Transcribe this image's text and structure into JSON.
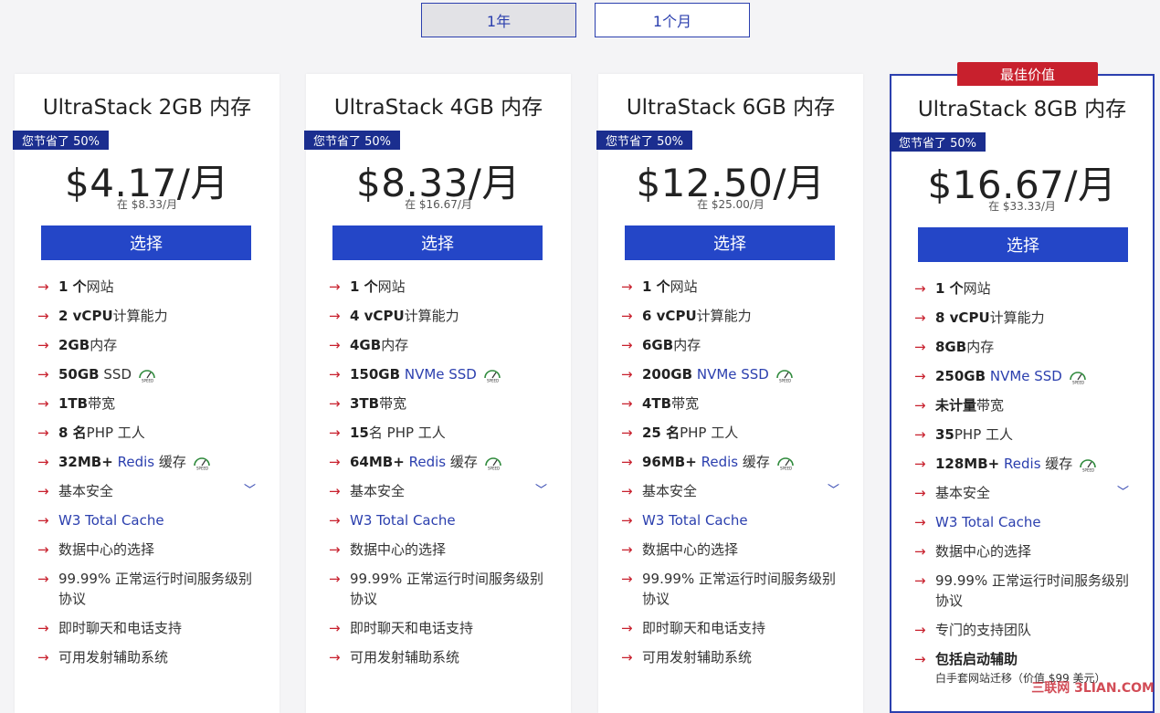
{
  "toggle": {
    "year": "1年",
    "month": "1个月"
  },
  "best_tag": "最佳价值",
  "save_badge": "您节省了 50%",
  "select_label": "选择",
  "plans": [
    {
      "title": "UltraStack 2GB 内存",
      "price": "$4.17/月",
      "orig": "在 $8.33/月",
      "features": {
        "sites_b": "1 个",
        "sites": "网站",
        "cpu_b": "2 vCPU",
        "cpu": "计算能力",
        "ram_b": "2GB",
        "ram": "内存",
        "ssd_b": "50GB",
        "ssd": "SSD",
        "bw_b": "1TB",
        "bw": "带宽",
        "php_b": "8 名",
        "php": "PHP 工人",
        "redis_b": "32MB+",
        "redis_link": "Redis",
        "redis": "缓存",
        "security": "基本安全",
        "w3": "W3 Total Cache",
        "dc": "数据中心的选择",
        "sla": "99.99% 正常运行时间服务级别协议",
        "chat": "即时聊天和电话支持",
        "launch": "可用发射辅助系统"
      }
    },
    {
      "title": "UltraStack 4GB 内存",
      "price": "$8.33/月",
      "orig": "在 $16.67/月",
      "features": {
        "sites_b": "1 个",
        "sites": "网站",
        "cpu_b": "4 vCPU",
        "cpu": "计算能力",
        "ram_b": "4GB",
        "ram": "内存",
        "ssd_b": "150GB",
        "ssd": "NVMe SSD",
        "bw_b": "3TB",
        "bw": "带宽",
        "php_b": "15",
        "php": "名 PHP 工人",
        "redis_b": "64MB+",
        "redis_link": "Redis",
        "redis": "缓存",
        "security": "基本安全",
        "w3": "W3 Total Cache",
        "dc": "数据中心的选择",
        "sla": "99.99% 正常运行时间服务级别协议",
        "chat": "即时聊天和电话支持",
        "launch": "可用发射辅助系统"
      }
    },
    {
      "title": "UltraStack 6GB 内存",
      "price": "$12.50/月",
      "orig": "在 $25.00/月",
      "features": {
        "sites_b": "1 个",
        "sites": "网站",
        "cpu_b": "6 vCPU",
        "cpu": "计算能力",
        "ram_b": "6GB",
        "ram": "内存",
        "ssd_b": "200GB",
        "ssd": "NVMe SSD",
        "bw_b": "4TB",
        "bw": "带宽",
        "php_b": "25 名",
        "php": "PHP 工人",
        "redis_b": "96MB+",
        "redis_link": "Redis",
        "redis": "缓存",
        "security": "基本安全",
        "w3": "W3 Total Cache",
        "dc": "数据中心的选择",
        "sla": "99.99% 正常运行时间服务级别协议",
        "chat": "即时聊天和电话支持",
        "launch": "可用发射辅助系统"
      }
    },
    {
      "title": "UltraStack 8GB 内存",
      "price": "$16.67/月",
      "orig": "在 $33.33/月",
      "features": {
        "sites_b": "1 个",
        "sites": "网站",
        "cpu_b": "8 vCPU",
        "cpu": "计算能力",
        "ram_b": "8GB",
        "ram": "内存",
        "ssd_b": "250GB",
        "ssd": "NVMe SSD",
        "bw_b": "未计量",
        "bw": "带宽",
        "php_b": "35",
        "php": "PHP 工人",
        "redis_b": "128MB+",
        "redis_link": "Redis",
        "redis": "缓存",
        "security": "基本安全",
        "w3": "W3 Total Cache",
        "dc": "数据中心的选择",
        "sla": "99.99% 正常运行时间服务级别协议",
        "team": "专门的支持团队",
        "launch_b": "包括启动辅助",
        "launch_sub": "白手套网站迁移（价值 $99 美元）"
      }
    }
  ],
  "watermark": "三联网 3LIAN.COM",
  "icons": {
    "arrow": "arrow-right-icon",
    "speed": "speed-gauge-icon",
    "chevron": "chevron-down-icon"
  },
  "colors": {
    "accent": "#2446c7",
    "badge": "#1b2e8f",
    "best": "#c8202d",
    "arrow": "#c8202d"
  }
}
